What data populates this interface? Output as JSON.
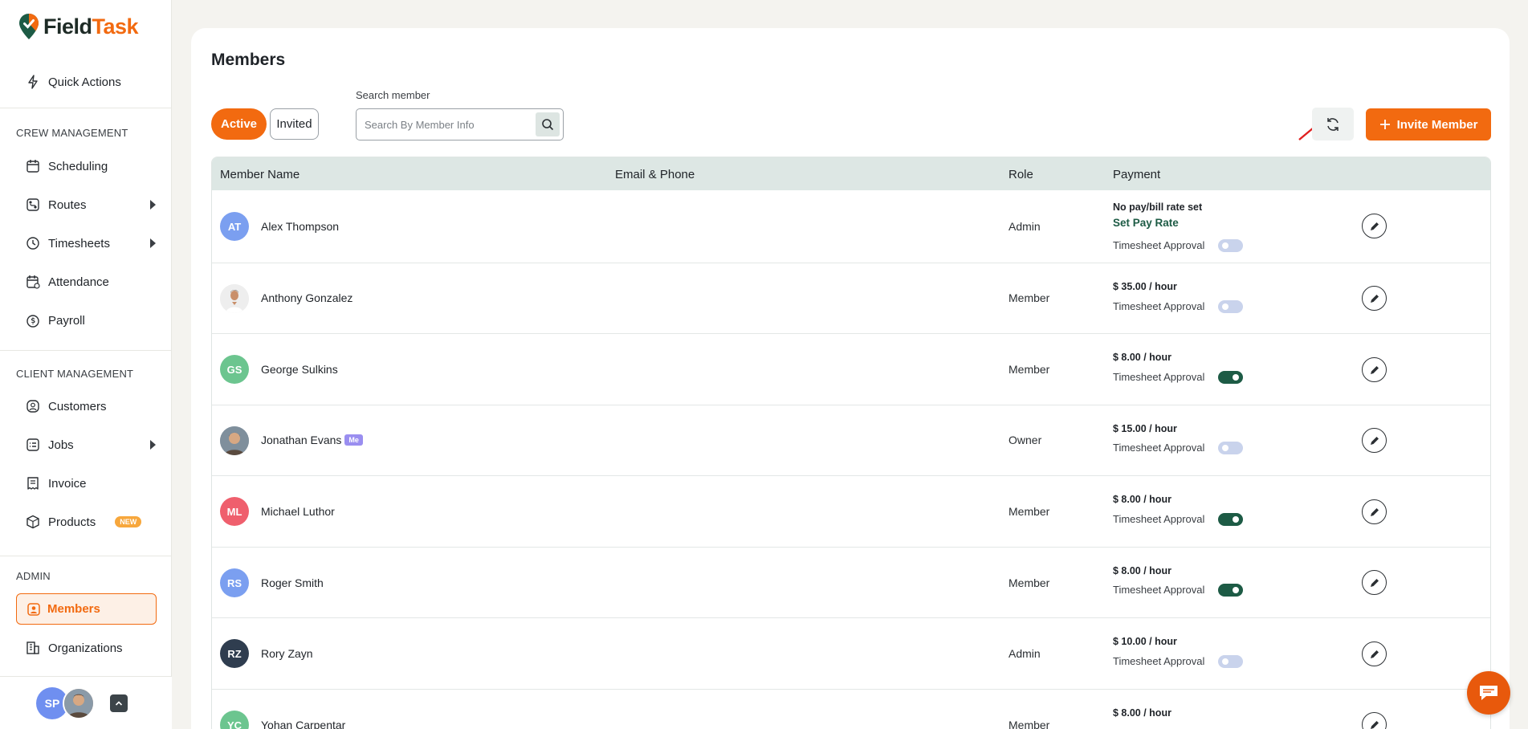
{
  "brand": {
    "name_part1": "Field",
    "name_part2": "Task",
    "accent": "#f26a10",
    "dark_green": "#1d5b45"
  },
  "sidebar": {
    "quick_actions": "Quick Actions",
    "crew_title": "CREW MANAGEMENT",
    "crew_items": [
      {
        "label": "Scheduling",
        "icon": "calendar-icon"
      },
      {
        "label": "Routes",
        "icon": "route-icon"
      },
      {
        "label": "Timesheets",
        "icon": "clock-icon"
      },
      {
        "label": "Attendance",
        "icon": "calendar-check-icon"
      },
      {
        "label": "Payroll",
        "icon": "payroll-icon"
      }
    ],
    "client_title": "CLIENT MANAGEMENT",
    "client_items": [
      {
        "label": "Customers",
        "icon": "user-circle-icon"
      },
      {
        "label": "Jobs",
        "icon": "jobs-icon"
      },
      {
        "label": "Invoice",
        "icon": "invoice-icon"
      },
      {
        "label": "Products",
        "icon": "box-icon",
        "badge": "NEW"
      }
    ],
    "admin_title": "ADMIN",
    "admin_items": [
      {
        "label": "Members",
        "icon": "member-icon",
        "active": true
      },
      {
        "label": "Organizations",
        "icon": "building-icon"
      }
    ],
    "user_initials": "SP"
  },
  "page": {
    "title": "Members",
    "tabs": {
      "active": "Active",
      "invited": "Invited"
    },
    "search_label": "Search member",
    "search_placeholder": "Search By Member Info",
    "invite_button": "Invite Member"
  },
  "table": {
    "headers": {
      "name": "Member Name",
      "contact": "Email & Phone",
      "role": "Role",
      "payment": "Payment"
    },
    "timesheet_label": "Timesheet Approval",
    "set_pay_rate": "Set Pay Rate",
    "me_badge": "Me",
    "rows": [
      {
        "initials": "AT",
        "name": "Alex Thompson",
        "role": "Admin",
        "pay": "No pay/bill rate set",
        "set_rate": true,
        "timesheet_approval": false,
        "avatar_color": "#7b9ff0"
      },
      {
        "initials": "",
        "name": "Anthony Gonzalez",
        "role": "Member",
        "pay": "$ 35.00 / hour",
        "timesheet_approval": false,
        "photo": true
      },
      {
        "initials": "GS",
        "name": "George Sulkins",
        "role": "Member",
        "pay": "$ 8.00 / hour",
        "timesheet_approval": true,
        "avatar_color": "#6cc58f"
      },
      {
        "initials": "",
        "name": "Jonathan Evans",
        "role": "Owner",
        "pay": "$ 15.00 / hour",
        "timesheet_approval": false,
        "photo": true,
        "me": true
      },
      {
        "initials": "ML",
        "name": "Michael Luthor",
        "role": "Member",
        "pay": "$ 8.00 / hour",
        "timesheet_approval": true,
        "avatar_color": "#ef5f6d"
      },
      {
        "initials": "RS",
        "name": "Roger Smith",
        "role": "Member",
        "pay": "$ 8.00 / hour",
        "timesheet_approval": true,
        "avatar_color": "#7b9ff0"
      },
      {
        "initials": "RZ",
        "name": "Rory Zayn",
        "role": "Admin",
        "pay": "$ 10.00 / hour",
        "timesheet_approval": false,
        "avatar_color": "#2f3d4f"
      },
      {
        "initials": "YC",
        "name": "Yohan Carpentar",
        "role": "Member",
        "pay": "$ 8.00 / hour",
        "timesheet_approval": false,
        "avatar_color": "#6cc58f"
      }
    ]
  }
}
